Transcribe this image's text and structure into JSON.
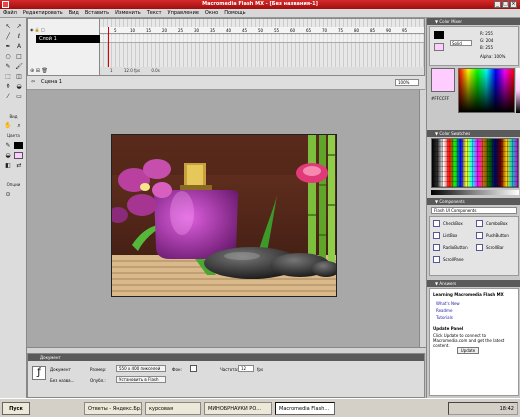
{
  "window": {
    "title": "Macromedia Flash MX - [Без названия-1]"
  },
  "menu": [
    "Файл",
    "Редактировать",
    "Вид",
    "Вставить",
    "Изменить",
    "Текст",
    "Управление",
    "Окно",
    "Помощь"
  ],
  "toolbox": {
    "view_label": "Вид",
    "colors_label": "Цвета",
    "options_label": "Опции"
  },
  "timeline": {
    "layer_name": "Слой 1",
    "ruler": [
      "5",
      "10",
      "15",
      "20",
      "25",
      "30",
      "35",
      "40",
      "45",
      "50",
      "55",
      "60",
      "65",
      "70",
      "75",
      "80",
      "85",
      "90",
      "95"
    ],
    "frame": "1",
    "fps": "12.0 fps",
    "time": "0.0s"
  },
  "scene": {
    "label": "Сцена 1",
    "zoom": "100%"
  },
  "properties": {
    "header": "Документ",
    "doc_label": "Документ",
    "name_label": "Без назва...",
    "size_label": "Размер:",
    "size_value": "550 x 400 пикселей",
    "bg_label": "Фон:",
    "fps_label": "Частота:",
    "fps_value": "12",
    "fps_unit": "fps",
    "publish_label": "Опубл.:",
    "publish_value": "Установить в Flash"
  },
  "panels": {
    "color_mixer_label": "Solid",
    "color_hex": "#FFCCFF",
    "r": "255",
    "g": "204",
    "b": "255",
    "alpha": "100%",
    "swatches_title": "Color Swatches",
    "components_title": "Flash UI Components",
    "components": [
      "CheckBox",
      "ComboBox",
      "ListBox",
      "PushButton",
      "RadioButton",
      "ScrollBar",
      "ScrollPane"
    ],
    "answers_title": "Answers",
    "learning_title": "Learning Macromedia Flash MX",
    "links": [
      "What's New",
      "Readme",
      "Tutorials"
    ],
    "update_title": "Update Panel",
    "update_text": "Click Update to connect to Macromedia.com and get the latest content.",
    "update_button": "Update"
  },
  "taskbar": {
    "start": "Пуск",
    "tasks": [
      "Ответы - Яндекс.Бр...",
      "курсовая",
      "МИНОБРНАУКИ РО...",
      "Macromedia Flash..."
    ],
    "clock": "18:42"
  }
}
